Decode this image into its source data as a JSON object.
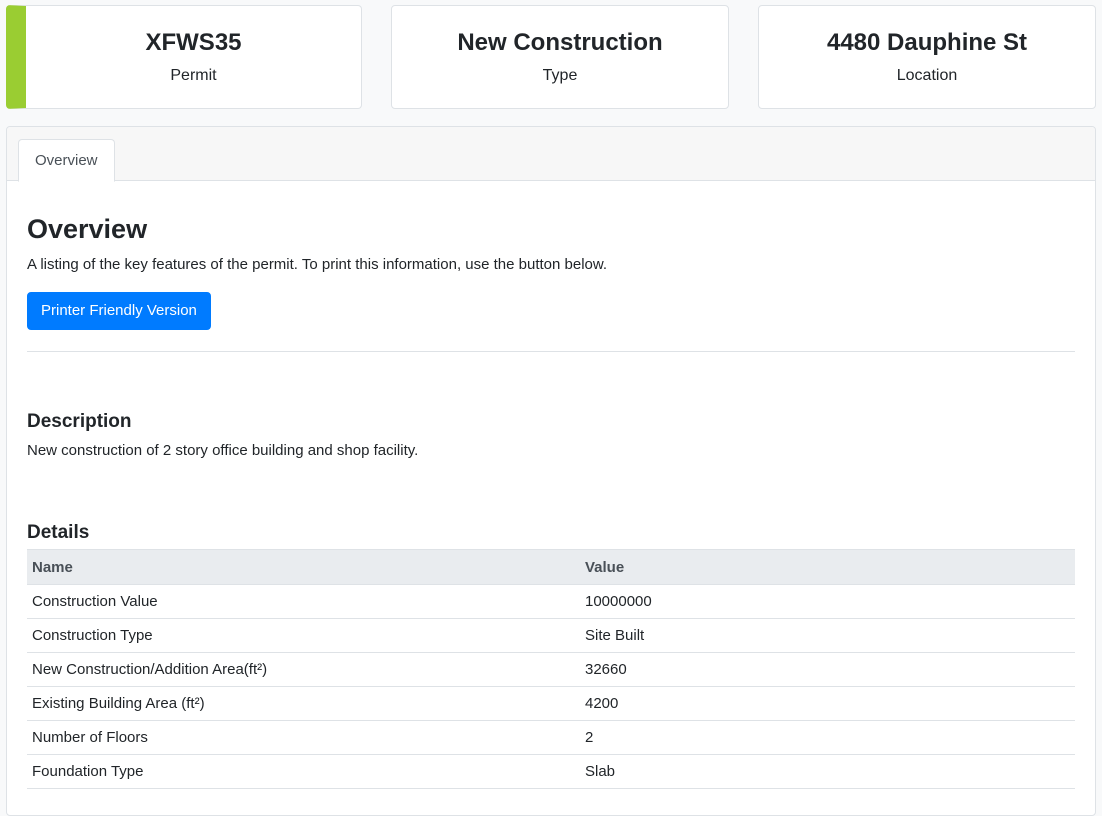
{
  "cards": [
    {
      "value": "XFWS35",
      "label": "Permit"
    },
    {
      "value": "New Construction",
      "label": "Type"
    },
    {
      "value": "4480 Dauphine St",
      "label": "Location"
    }
  ],
  "accent_color": "#9acd32",
  "tabs": [
    {
      "label": "Overview"
    }
  ],
  "overview": {
    "title": "Overview",
    "intro": "A listing of the key features of the permit. To print this information, use the button below.",
    "print_button": "Printer Friendly Version"
  },
  "description": {
    "heading": "Description",
    "text": "New construction of 2 story office building and shop facility."
  },
  "details": {
    "heading": "Details",
    "columns": [
      "Name",
      "Value"
    ],
    "rows": [
      {
        "name": "Construction Value",
        "value": "10000000"
      },
      {
        "name": "Construction Type",
        "value": "Site Built"
      },
      {
        "name": "New Construction/Addition Area(ft²)",
        "value": "32660"
      },
      {
        "name": "Existing Building Area (ft²)",
        "value": "4200"
      },
      {
        "name": "Number of Floors",
        "value": "2"
      },
      {
        "name": "Foundation Type",
        "value": "Slab"
      }
    ]
  }
}
